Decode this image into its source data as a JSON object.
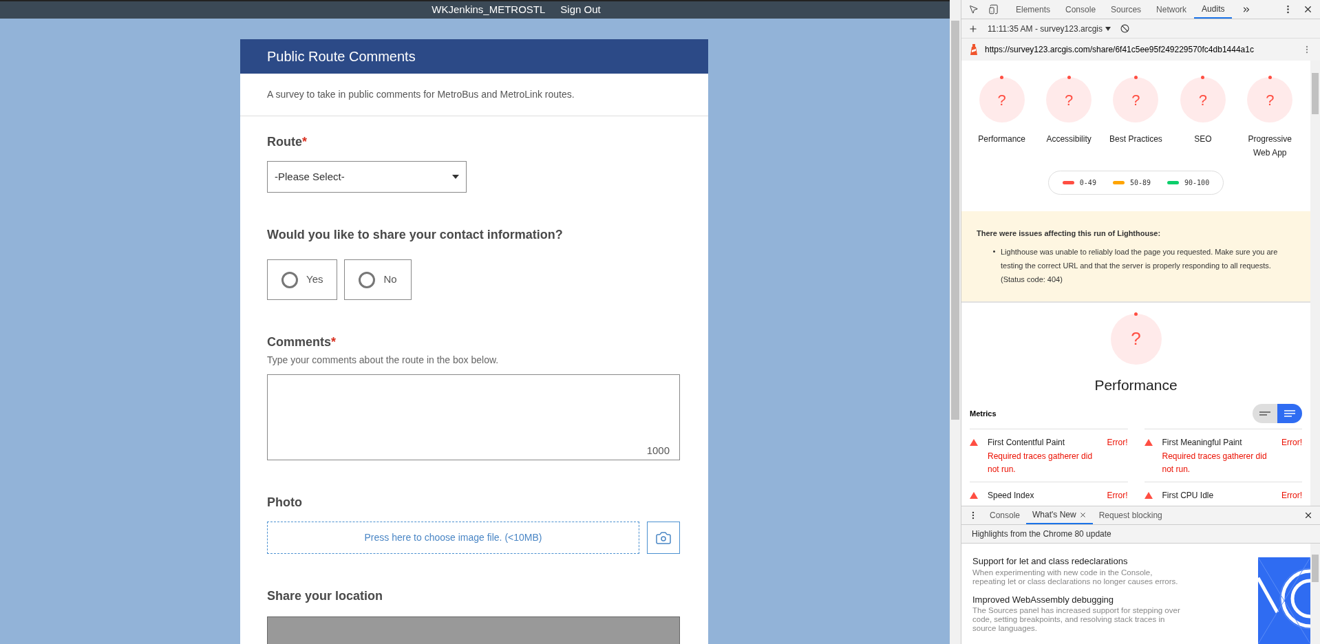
{
  "header": {
    "user": "WKJenkins_METROSTL",
    "sign_out": "Sign Out"
  },
  "survey": {
    "title": "Public Route Comments",
    "description": "A survey to take in public comments for MetroBus and MetroLink routes.",
    "questions": [
      {
        "kind": "select",
        "label": "Route",
        "required_mark": "*",
        "placeholder": "-Please Select-"
      },
      {
        "kind": "radio",
        "label": "Would you like to share your contact information?",
        "options": [
          {
            "label": "Yes",
            "selected": false
          },
          {
            "label": "No",
            "selected": false
          }
        ]
      },
      {
        "kind": "textarea",
        "label": "Comments",
        "required_mark": "*",
        "hint": "Type your comments about the route in the box below.",
        "counter": "1000"
      },
      {
        "label": "Photo",
        "placeholder": "Press here to choose image file. (<10MB)"
      },
      {
        "kind": "map",
        "label": "Share your location"
      }
    ]
  },
  "devtools": {
    "tabs": [
      {
        "label": "Elements",
        "selected": false
      },
      {
        "label": "Console",
        "selected": false
      },
      {
        "label": "Sources",
        "selected": false
      },
      {
        "label": "Network",
        "selected": false
      },
      {
        "label": "Audits",
        "selected": true
      }
    ],
    "report": "11:11:35 AM - survey123.arcgis",
    "url": "https://survey123.arcgis.com/share/6f41c5ee95f249229570fc4db1444a1c",
    "categories": [
      {
        "label": "Performance",
        "score": "?"
      },
      {
        "label": "Accessibility",
        "score": "?"
      },
      {
        "label": "Best Practices",
        "score": "?"
      },
      {
        "label": "SEO",
        "score": "?"
      },
      {
        "label": "Progressive Web App",
        "score": "?"
      }
    ],
    "legend": [
      {
        "label": "0-49",
        "color": "#ff4e42"
      },
      {
        "label": "50-89",
        "color": "#ffa400"
      },
      {
        "label": "90-100",
        "color": "#0cce6b"
      }
    ],
    "warning": {
      "title": "There were issues affecting this run of Lighthouse:",
      "items": [
        "Lighthouse was unable to reliably load the page you requested. Make sure you are testing the correct URL and that the server is properly responding to all requests. (Status code: 404)"
      ]
    },
    "section": {
      "score": "?",
      "title": "Performance"
    },
    "metrics_title": "Metrics",
    "view_toggle": [
      {
        "kind": "compact",
        "selected": false
      },
      {
        "kind": "expanded",
        "selected": true
      }
    ],
    "metrics": [
      {
        "name": "First Contentful Paint",
        "value": "Error!",
        "message": "Required traces gatherer did not run."
      },
      {
        "name": "First Meaningful Paint",
        "value": "Error!",
        "message": "Required traces gatherer did not run."
      },
      {
        "name": "Speed Index",
        "value": "Error!"
      },
      {
        "name": "First CPU Idle",
        "value": "Error!"
      }
    ],
    "drawer": {
      "tabs": [
        {
          "label": "Console",
          "selected": false,
          "closable": false
        },
        {
          "label": "What's New",
          "selected": true,
          "closable": true
        },
        {
          "label": "Request blocking",
          "selected": false,
          "closable": false
        }
      ],
      "subtitle": "Highlights from the Chrome 80 update",
      "features": [
        {
          "title": "Support for let and class redeclarations",
          "body": "When experimenting with new code in the Console, repeating let or class declarations no longer causes errors."
        },
        {
          "title": "Improved WebAssembly debugging",
          "body": "The Sources panel has increased support for stepping over code, setting breakpoints, and resolving stack traces in source languages."
        }
      ]
    }
  }
}
